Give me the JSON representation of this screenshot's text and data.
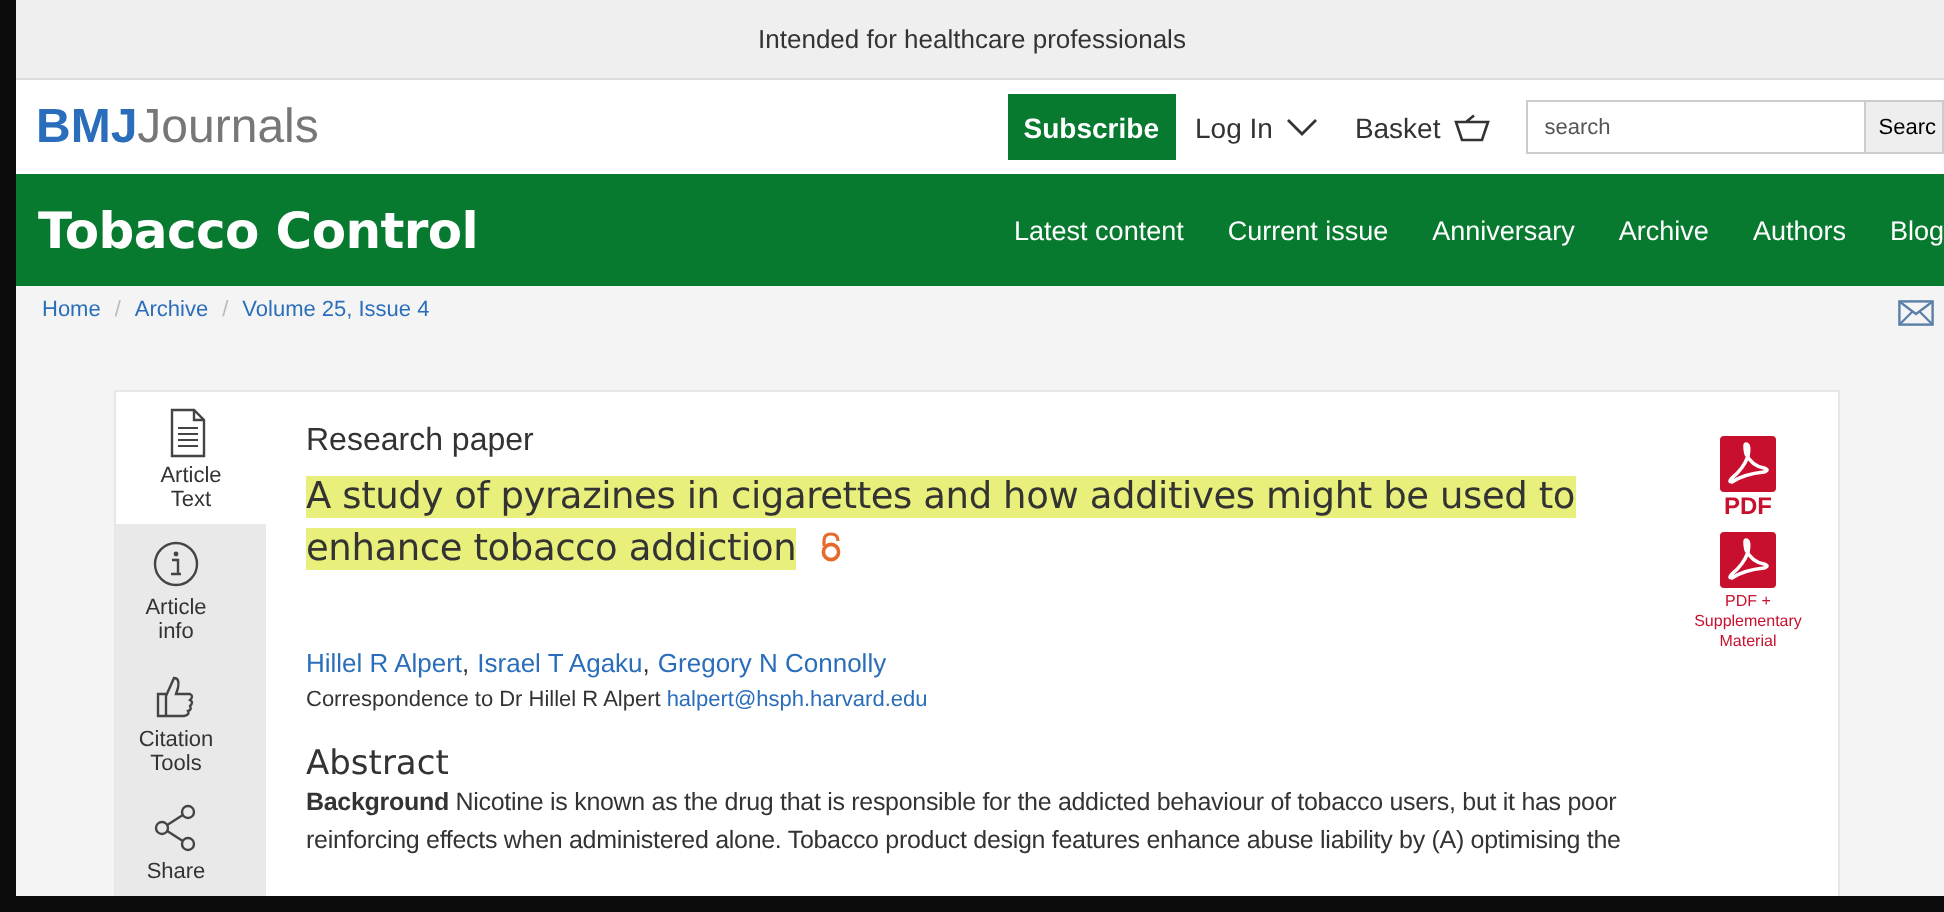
{
  "top_notice": "Intended for healthcare professionals",
  "header": {
    "logo_bold": "BMJ",
    "logo_light": "Journals",
    "subscribe": "Subscribe",
    "login": "Log In",
    "basket": "Basket",
    "search": {
      "placeholder": "search"
    },
    "search_button": "Searc"
  },
  "journal": {
    "title": "Tobacco Control",
    "nav": [
      {
        "label": "Latest content"
      },
      {
        "label": "Current issue"
      },
      {
        "label": "Anniversary"
      },
      {
        "label": "Archive"
      },
      {
        "label": "Authors"
      },
      {
        "label": "Blog"
      }
    ]
  },
  "breadcrumbs": [
    {
      "label": "Home"
    },
    {
      "label": "Archive",
      "separator": "/"
    },
    {
      "label": "Volume 25, Issue 4",
      "separator": "/"
    }
  ],
  "side_tabs": [
    {
      "kind": "document",
      "label": "Article Text",
      "selected": true
    },
    {
      "kind": "info",
      "label": "Article info",
      "selected": false
    },
    {
      "kind": "thumb",
      "label": "Citation Tools",
      "selected": false
    },
    {
      "kind": "share",
      "label": "Share",
      "selected": false
    }
  ],
  "article": {
    "type": "Research paper",
    "title": "A study of pyrazines in cigarettes and how additives might be used to enhance tobacco addiction",
    "open_access": true,
    "authors": [
      {
        "name": "Hillel R Alpert",
        "comma": ","
      },
      {
        "name": "Israel T Agaku",
        "comma": ","
      },
      {
        "name": "Gregory N Connolly"
      }
    ],
    "correspondence": "Correspondence to Dr Hillel R Alpert",
    "email": "halpert@hsph.harvard.edu",
    "abstract_heading": "Abstract",
    "abstract": "**Background** Nicotine is known as the drug that is responsible for the addicted behaviour of tobacco users, but it has poor reinforcing effects when administered alone. Tobacco product design features enhance abuse liability by (A) optimising the",
    "downloads": [
      {
        "label": "PDF"
      },
      {
        "label": "PDF + Supplementary Material"
      }
    ]
  }
}
